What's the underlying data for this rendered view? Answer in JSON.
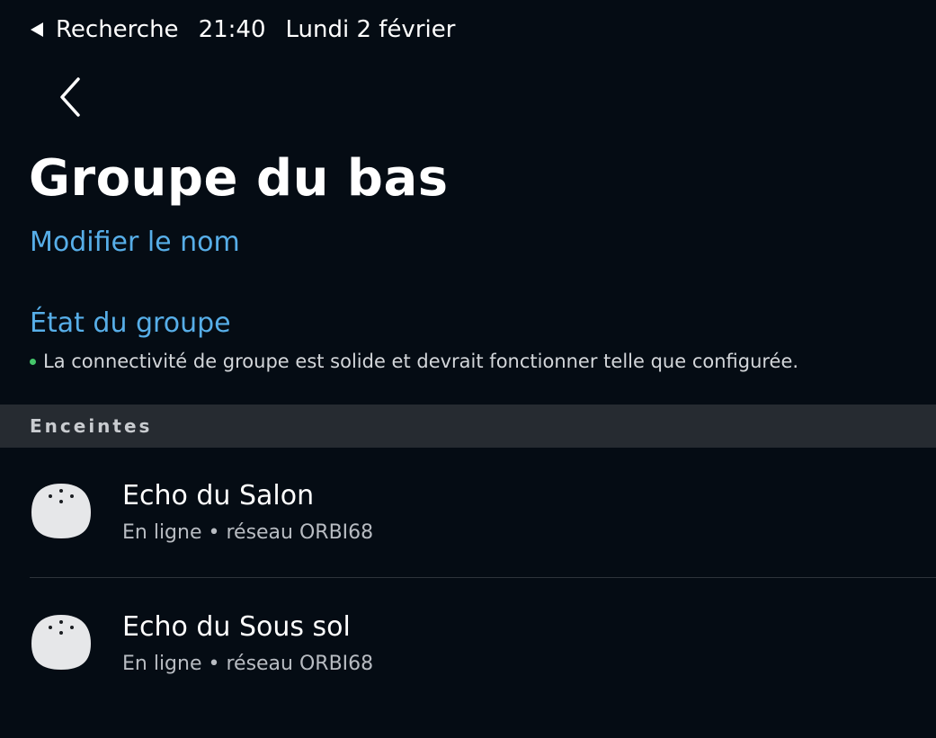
{
  "status_bar": {
    "back_app_label": "Recherche",
    "time": "21:40",
    "date": "Lundi 2 février"
  },
  "header": {
    "title": "Groupe du bas",
    "rename_link": "Modifier le nom"
  },
  "group_status": {
    "heading": "État du groupe",
    "message": "La connectivité de groupe est solide et devrait fonctionner telle que configurée.",
    "indicator_color": "#45c66a"
  },
  "speakers_section": {
    "title": "Enceintes",
    "devices": [
      {
        "name": "Echo du Salon",
        "status": "En ligne • réseau ORBI68",
        "icon": "echo-dot-icon"
      },
      {
        "name": "Echo du Sous sol",
        "status": "En ligne • réseau ORBI68",
        "icon": "echo-dot-icon"
      }
    ]
  },
  "colors": {
    "background": "#050c14",
    "accent_link": "#57aee8",
    "section_header_bg": "#262b31"
  }
}
